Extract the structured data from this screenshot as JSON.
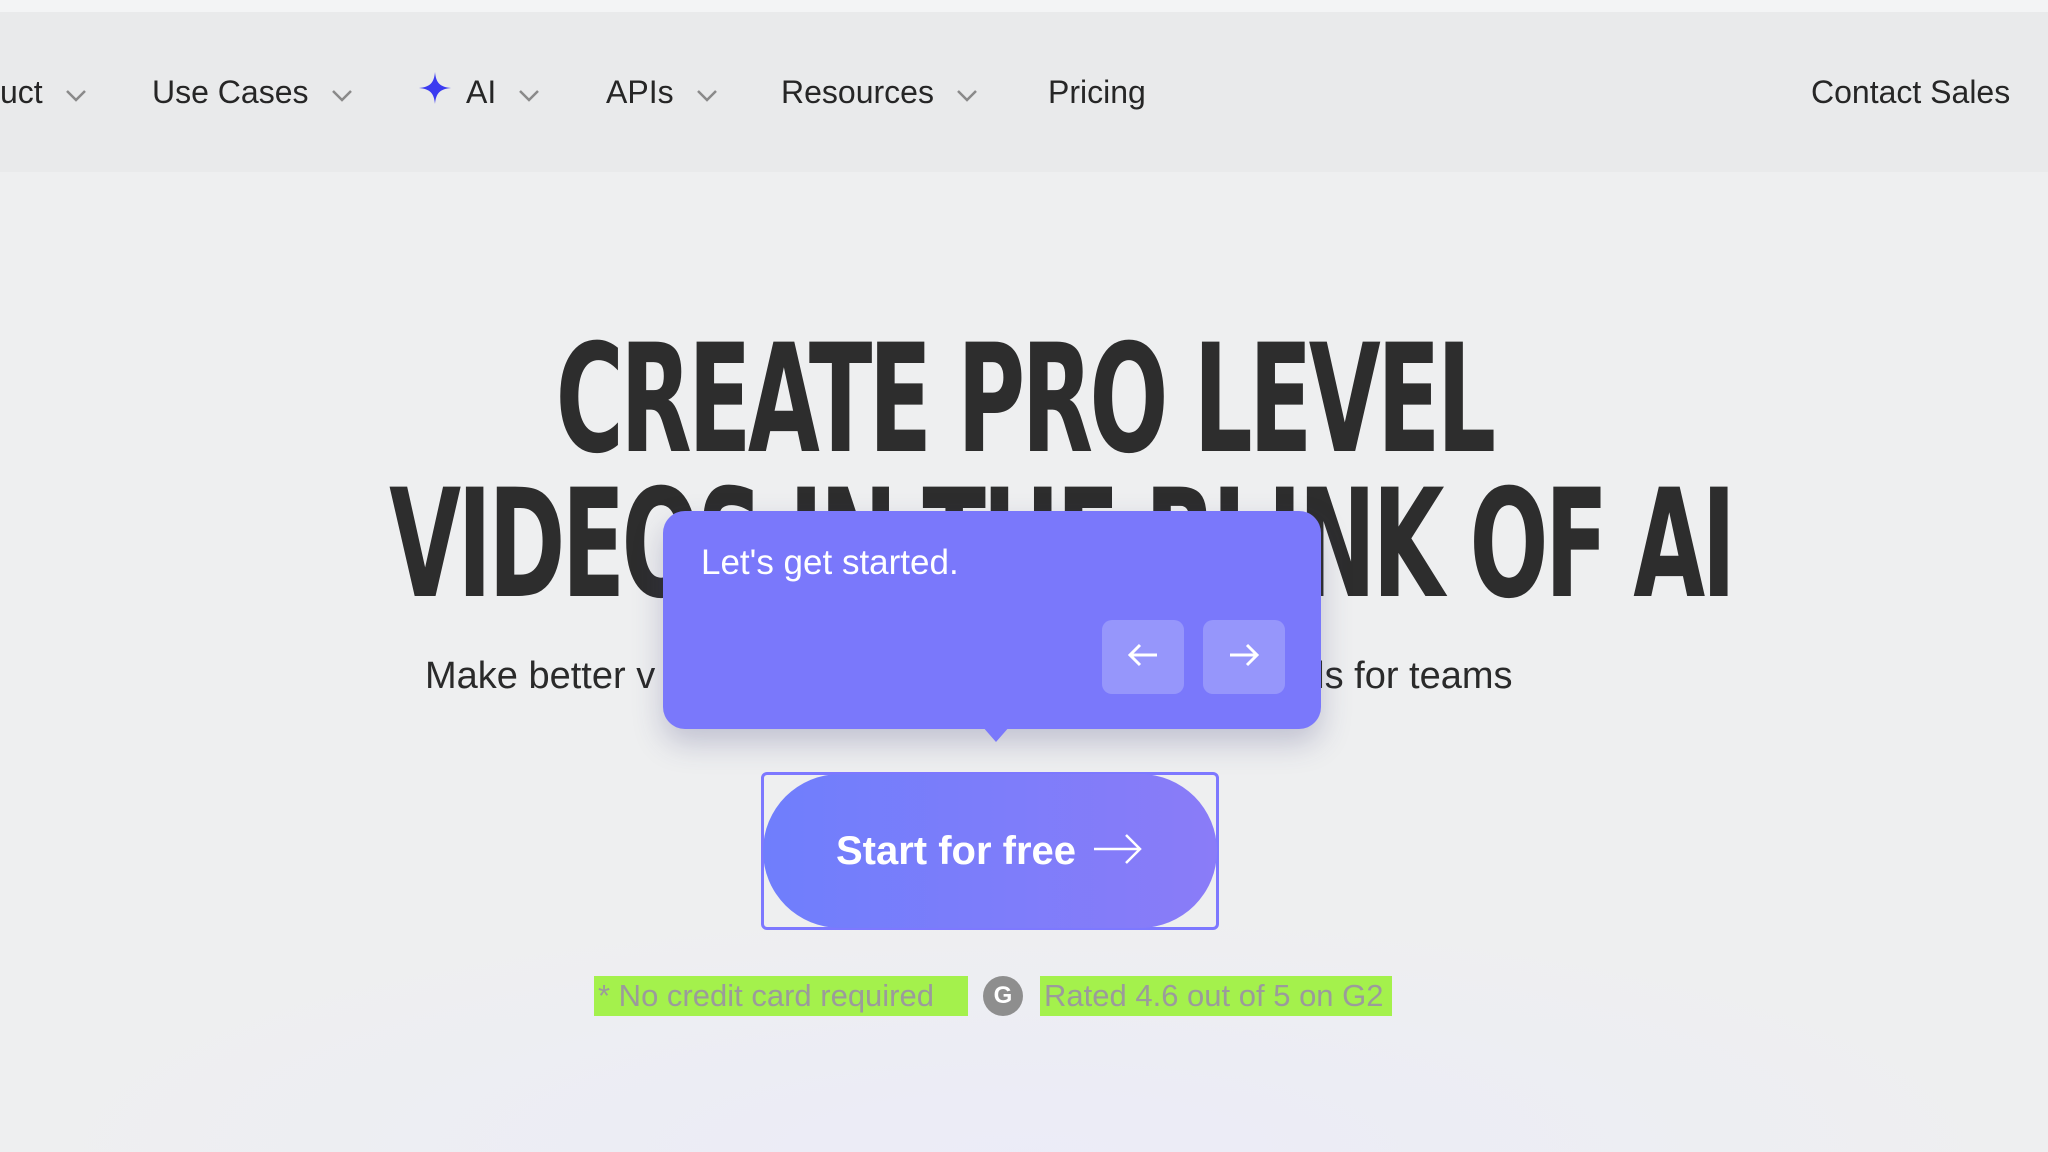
{
  "nav": {
    "items": [
      {
        "label": "uct",
        "has_chevron": true
      },
      {
        "label": "Use Cases",
        "has_chevron": true
      },
      {
        "label": "AI",
        "has_chevron": true,
        "icon": "sparkle-icon"
      },
      {
        "label": "APIs",
        "has_chevron": true
      },
      {
        "label": "Resources",
        "has_chevron": true
      },
      {
        "label": "Pricing",
        "has_chevron": false
      }
    ],
    "contact_label": "Contact Sales"
  },
  "hero": {
    "line1": "CREATE PRO LEVEL",
    "line2": "VIDEOS IN THE BLINK OF AI",
    "subtitle_left": "Make better v",
    "subtitle_right": "ols for teams"
  },
  "tooltip": {
    "text": "Let's get started.",
    "prev_icon": "arrow-left-icon",
    "next_icon": "arrow-right-icon"
  },
  "cta": {
    "label": "Start for free",
    "icon": "arrow-right-icon"
  },
  "notes": {
    "no_card": "* No credit card required",
    "rating": "Rated 4.6 out of 5 on G2",
    "g2_icon": "g2-logo-icon"
  },
  "colors": {
    "accent": "#7a78fb",
    "highlight": "#a4f14c",
    "sparkle": "#3b3bf0"
  }
}
